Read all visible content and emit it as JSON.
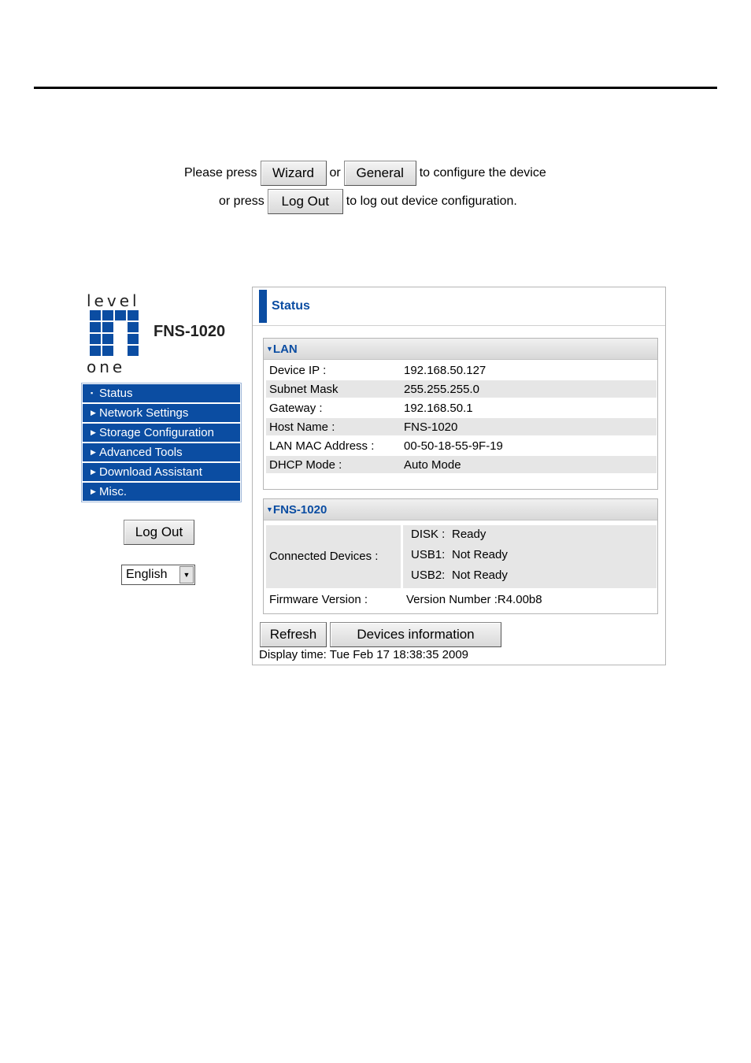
{
  "instructions": {
    "line1_prefix": "Please press",
    "wizard_button": "Wizard",
    "or": "or",
    "general_button": "General",
    "line1_suffix": "to configure the device",
    "line2_prefix": "or press",
    "logout_button": "Log Out",
    "line2_suffix": "to log out device configuration."
  },
  "logo": {
    "word_top": "level",
    "word_bottom": "one",
    "model": "FNS-1020",
    "brand_color": "#0b4da2"
  },
  "sidebar": {
    "items": [
      {
        "label": "Status",
        "icon": "bullet-icon"
      },
      {
        "label": "Network Settings",
        "icon": "triangle-right-icon"
      },
      {
        "label": "Storage Configuration",
        "icon": "triangle-right-icon"
      },
      {
        "label": "Advanced Tools",
        "icon": "triangle-right-icon"
      },
      {
        "label": "Download Assistant",
        "icon": "triangle-right-icon"
      },
      {
        "label": "Misc.",
        "icon": "triangle-right-icon"
      }
    ],
    "logout_button": "Log Out",
    "language": "English"
  },
  "status": {
    "title": "Status",
    "lan": {
      "title": "LAN",
      "rows": [
        {
          "label": "Device IP :",
          "value": "192.168.50.127"
        },
        {
          "label": "Subnet Mask",
          "value": "255.255.255.0"
        },
        {
          "label": "Gateway :",
          "value": "192.168.50.1"
        },
        {
          "label": "Host Name :",
          "value": "FNS-1020"
        },
        {
          "label": "LAN MAC Address :",
          "value": "00-50-18-55-9F-19"
        },
        {
          "label": "DHCP Mode :",
          "value": "Auto Mode"
        }
      ]
    },
    "device": {
      "title": "FNS-1020",
      "connected_label": "Connected Devices :",
      "connected": [
        {
          "name": "DISK :",
          "state": "Ready"
        },
        {
          "name": "USB1:",
          "state": "Not Ready"
        },
        {
          "name": "USB2:",
          "state": "Not Ready"
        }
      ],
      "firmware_label": "Firmware Version :",
      "firmware_value": "Version Number :R4.00b8"
    },
    "refresh_button": "Refresh",
    "devices_button": "Devices information",
    "display_time": "Display time: Tue Feb 17 18:38:35 2009"
  }
}
